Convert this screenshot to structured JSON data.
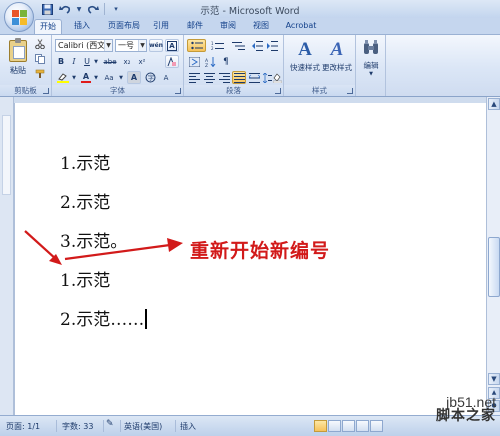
{
  "window": {
    "title": "示范 - Microsoft Word"
  },
  "quick_access": {
    "save_icon": "save-icon",
    "undo_icon": "undo-icon",
    "redo_icon": "redo-icon"
  },
  "tabs": [
    {
      "label": "开始",
      "active": true
    },
    {
      "label": "插入",
      "active": false
    },
    {
      "label": "页面布局",
      "active": false
    },
    {
      "label": "引用",
      "active": false
    },
    {
      "label": "邮件",
      "active": false
    },
    {
      "label": "审阅",
      "active": false
    },
    {
      "label": "视图",
      "active": false
    },
    {
      "label": "Acrobat",
      "active": false
    }
  ],
  "ribbon": {
    "clipboard": {
      "paste_label": "粘贴",
      "group_label": "剪贴板"
    },
    "font": {
      "font_name": "Calibri (西文正",
      "font_size": "一号",
      "group_label": "字体",
      "bold": "B",
      "italic": "I",
      "underline": "U",
      "strike": "abe",
      "subscript": "x₂",
      "superscript": "x²",
      "change_case": "Aa",
      "font_color": "A",
      "grow": "A",
      "clear": "A",
      "phonetic": "wén",
      "border_char": "A"
    },
    "paragraph": {
      "group_label": "段落"
    },
    "styles": {
      "quick_styles": "快速样式",
      "change_styles": "更改样式",
      "group_label": "样式"
    },
    "editing": {
      "label": "编辑"
    }
  },
  "document": {
    "lines": [
      "1.示范",
      "2.示范",
      "3.示范。",
      "1.示范",
      "2.示范……"
    ],
    "annotation": "重新开始新编号"
  },
  "status": {
    "page": "页面: 1/1",
    "words": "字数: 33",
    "language": "英语(美国)",
    "mode": "插入"
  },
  "watermark": {
    "site": "jb51.net",
    "name": "脚本之家"
  },
  "colors": {
    "accent": "#15428b",
    "annotation": "#d21a1a",
    "ribbon_bg": "#dbe6f6"
  }
}
